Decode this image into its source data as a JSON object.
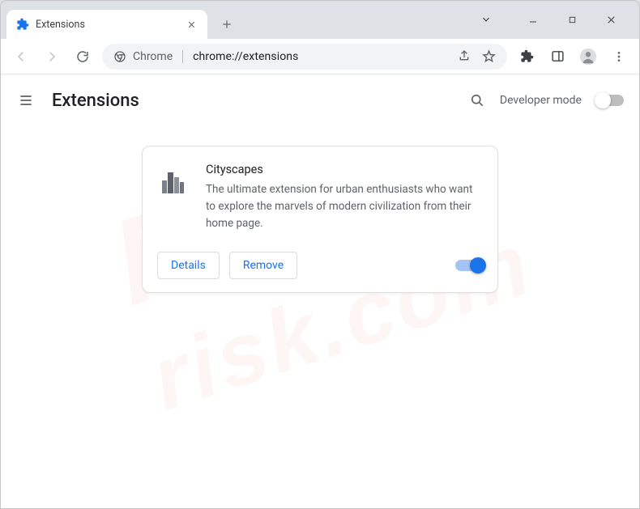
{
  "browser": {
    "tab": {
      "title": "Extensions"
    },
    "omnibox": {
      "origin": "Chrome",
      "url": "chrome://extensions"
    }
  },
  "page": {
    "title": "Extensions",
    "developer_mode_label": "Developer mode",
    "developer_mode_on": false
  },
  "extension": {
    "name": "Cityscapes",
    "description": "The ultimate extension for urban enthusiasts who want to explore the marvels of modern civilization from their home page.",
    "enabled": true,
    "buttons": {
      "details": "Details",
      "remove": "Remove"
    }
  },
  "watermark": {
    "line1": "PC",
    "line2": "risk.com"
  }
}
